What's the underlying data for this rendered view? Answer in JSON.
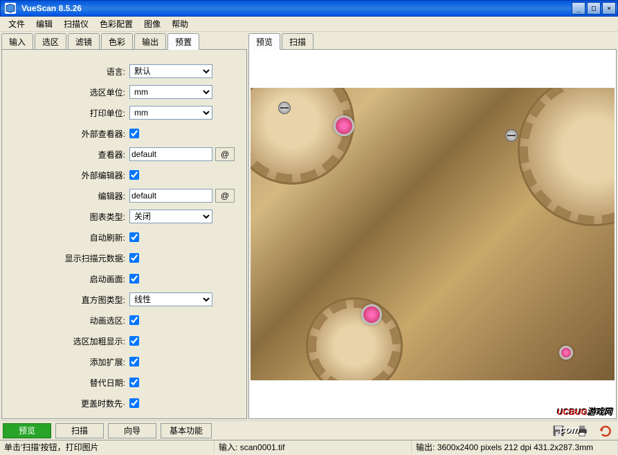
{
  "window": {
    "title": "VueScan 8.5.26"
  },
  "menu": {
    "file": "文件",
    "edit": "编辑",
    "scanner": "扫描仪",
    "color_config": "色彩配置",
    "image": "图像",
    "help": "帮助"
  },
  "left_tabs": {
    "input": "输入",
    "crop": "选区",
    "filter": "滤镜",
    "color": "色彩",
    "output": "输出",
    "prefs": "预置"
  },
  "right_tabs": {
    "preview": "预览",
    "scan": "扫描"
  },
  "prefs": {
    "language_label": "语言:",
    "language_value": "默认",
    "crop_units_label": "选区单位:",
    "crop_units_value": "mm",
    "print_units_label": "打印单位:",
    "print_units_value": "mm",
    "external_viewer_label": "外部查看器:",
    "viewer_label": "查看器:",
    "viewer_value": "default",
    "external_editor_label": "外部编辑器:",
    "editor_label": "编辑器:",
    "editor_value": "default",
    "graph_type_label": "图表类型:",
    "graph_type_value": "关闭",
    "auto_refresh_label": "自动刷新:",
    "show_metadata_label": "显示扫描元数据:",
    "splash_screen_label": "启动画面:",
    "histogram_type_label": "直方图类型:",
    "histogram_type_value": "线性",
    "animate_crop_label": "动画选区:",
    "thick_crop_label": "选区加粗显示:",
    "add_ext_label": "添加扩展:",
    "substitute_date_label": "替代日期:",
    "more_label": "更盖时数先·",
    "at_button": "@"
  },
  "buttons": {
    "preview": "预览",
    "scan": "扫描",
    "guide": "向导",
    "basic": "基本功能"
  },
  "status": {
    "hint": "单击'扫描'按钮，打印图片",
    "input_label": "输入:",
    "input_value": "scan0001.tif",
    "output_label": "输出:",
    "output_value": "3600x2400 pixels 212 dpi 431.2x287.3mm"
  },
  "watermark": {
    "brand": "UCBUG",
    "suffix": "游戏网",
    "domain": ".com"
  }
}
